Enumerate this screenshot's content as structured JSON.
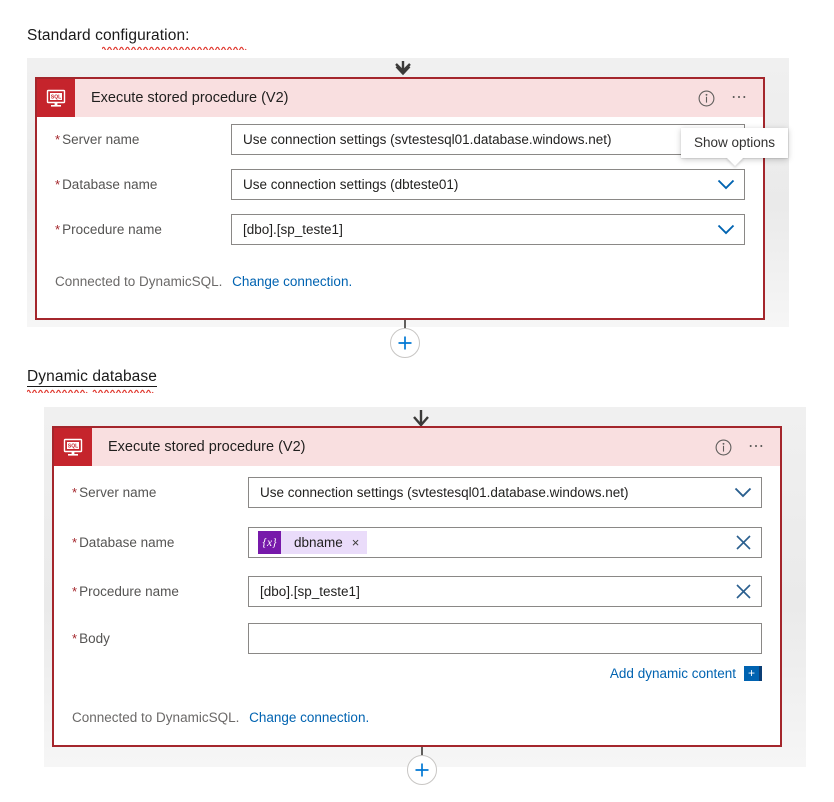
{
  "sections": [
    {
      "heading": "Standard configuration:"
    },
    {
      "heading": "Dynamic database"
    }
  ],
  "tooltip": {
    "text": "Show options"
  },
  "card_standard": {
    "title": "Execute stored procedure (V2)",
    "icon": "sql-server-icon",
    "info_icon": "info-icon",
    "more_icon": "more-options-icon",
    "fields": [
      {
        "label": "Server name",
        "required": true,
        "value": "Use connection settings (svtestesql01.database.windows.net)",
        "affordance": "chevron-down-icon"
      },
      {
        "label": "Database name",
        "required": true,
        "value": "Use connection settings (dbteste01)",
        "affordance": "chevron-down-icon"
      },
      {
        "label": "Procedure name",
        "required": true,
        "value": "[dbo].[sp_teste1]",
        "affordance": "chevron-down-icon"
      }
    ],
    "footer": {
      "status": "Connected to DynamicSQL.",
      "link": "Change connection."
    }
  },
  "card_dynamic": {
    "title": "Execute stored procedure (V2)",
    "icon": "sql-server-icon",
    "info_icon": "info-icon",
    "more_icon": "more-options-icon",
    "fields": [
      {
        "label": "Server name",
        "required": true,
        "value": "Use connection settings (svtestesql01.database.windows.net)",
        "affordance": "chevron-down-icon"
      },
      {
        "label": "Database name",
        "required": true,
        "token": {
          "badge": "{x}",
          "text": "dbname",
          "remove": "×"
        },
        "affordance": "clear-x-icon"
      },
      {
        "label": "Procedure name",
        "required": true,
        "value": "[dbo].[sp_teste1]",
        "affordance": "clear-x-icon"
      },
      {
        "label": "Body",
        "required": true,
        "value": "",
        "affordance": "none"
      }
    ],
    "add_dynamic_content": {
      "label": "Add dynamic content",
      "icon": "add-dynamic-content-icon",
      "icon_glyph": "+"
    },
    "footer": {
      "status": "Connected to DynamicSQL.",
      "link": "Change connection."
    }
  },
  "colors": {
    "card_border": "#a4262c",
    "card_header_bg": "#f9dfe0",
    "icon_bg": "#c5242c",
    "link": "#0063b1",
    "token_badge": "#7719aa",
    "token_bg": "#eadcfa",
    "required_star": "#a4262c",
    "canvas_bg": "#eaeaea"
  }
}
